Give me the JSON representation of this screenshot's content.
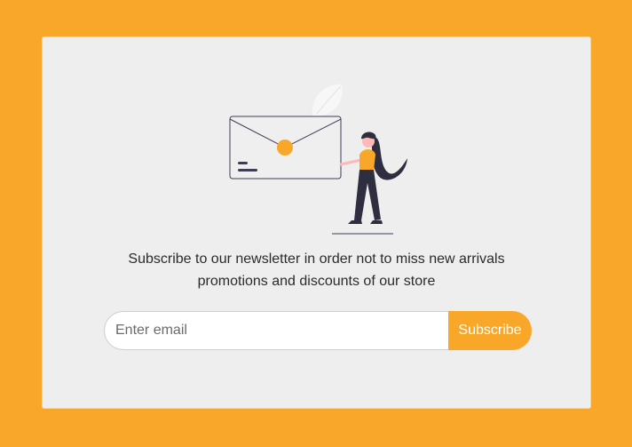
{
  "newsletter": {
    "message_line1": "Subscribe to our newsletter in order not to miss new arrivals",
    "message_line2": "promotions and discounts of our store",
    "email_placeholder": "Enter email",
    "subscribe_label": "Subscribe",
    "illustration": "woman-holding-envelope-icon"
  },
  "colors": {
    "page_background": "#f9a728",
    "card_background": "#eeeeee",
    "accent": "#f9a728",
    "text": "#2b2b2b",
    "figure_dark": "#2f2e41"
  }
}
